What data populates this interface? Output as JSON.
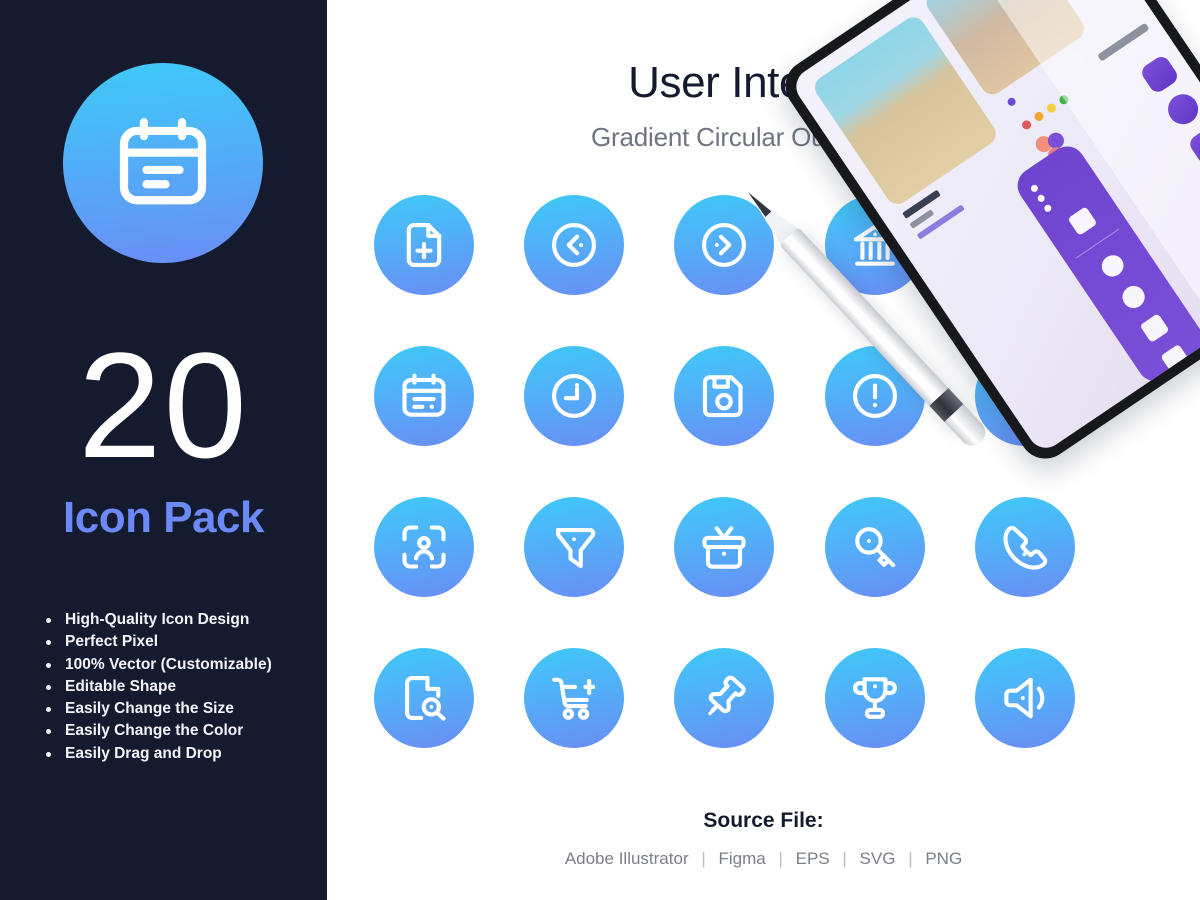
{
  "sidebar": {
    "badge_icon": "calendar-icon",
    "count": "20",
    "pack_title": "Icon Pack",
    "features": [
      "High-Quality Icon Design",
      "Perfect Pixel",
      "100% Vector (Customizable)",
      "Editable Shape",
      "Easily Change the Size",
      "Easily Change the Color",
      "Easily Drag and Drop"
    ],
    "background_color": "#151b2e",
    "title_color": "#6b8af7"
  },
  "header": {
    "title": "User Interface",
    "subtitle": "Gradient Circular Outline Style"
  },
  "gradient": {
    "start": "#3fc9f7",
    "end": "#6a8df5"
  },
  "icons": [
    {
      "name": "file-add-icon",
      "row": 1,
      "col": 1
    },
    {
      "name": "chevron-left-circle-icon",
      "row": 1,
      "col": 2
    },
    {
      "name": "chevron-right-circle-icon",
      "row": 1,
      "col": 3
    },
    {
      "name": "bank-icon",
      "row": 1,
      "col": 4
    },
    {
      "name": "flash-icon",
      "row": 1,
      "col": 5
    },
    {
      "name": "calendar-icon",
      "row": 2,
      "col": 1
    },
    {
      "name": "clock-icon",
      "row": 2,
      "col": 2
    },
    {
      "name": "save-disk-icon",
      "row": 2,
      "col": 3
    },
    {
      "name": "alert-circle-icon",
      "row": 2,
      "col": 4
    },
    {
      "name": "alert-triangle-icon",
      "row": 2,
      "col": 5
    },
    {
      "name": "face-scan-icon",
      "row": 3,
      "col": 1
    },
    {
      "name": "filter-funnel-icon",
      "row": 3,
      "col": 2
    },
    {
      "name": "gift-icon",
      "row": 3,
      "col": 3
    },
    {
      "name": "key-icon",
      "row": 3,
      "col": 4
    },
    {
      "name": "phone-call-icon",
      "row": 3,
      "col": 5
    },
    {
      "name": "file-search-icon",
      "row": 4,
      "col": 1
    },
    {
      "name": "cart-add-icon",
      "row": 4,
      "col": 2
    },
    {
      "name": "pushpin-icon",
      "row": 4,
      "col": 3
    },
    {
      "name": "trophy-icon",
      "row": 4,
      "col": 4
    },
    {
      "name": "volume-icon",
      "row": 4,
      "col": 5
    }
  ],
  "footer": {
    "source_title": "Source File:",
    "formats": [
      "Adobe Illustrator",
      "Figma",
      "EPS",
      "SVG",
      "PNG"
    ],
    "separator": "|"
  }
}
